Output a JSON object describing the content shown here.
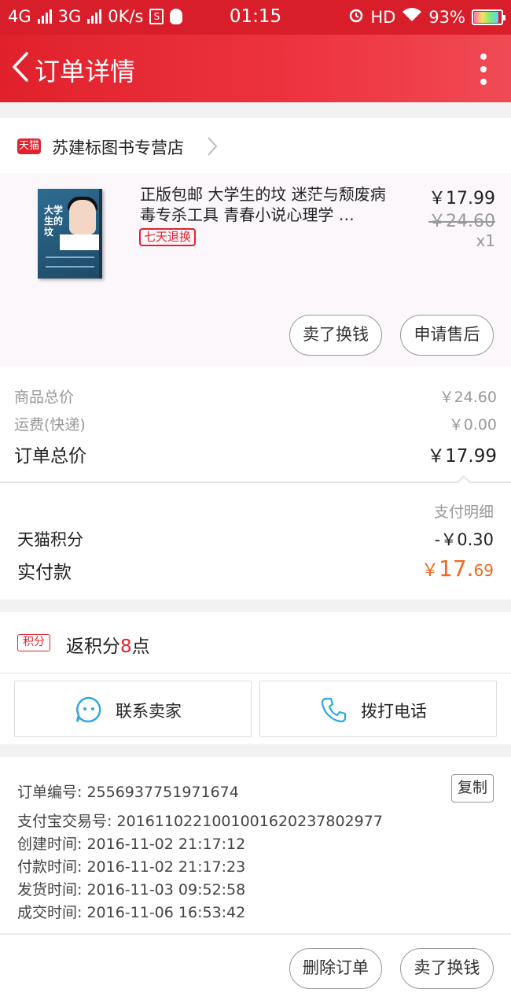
{
  "status_bar": {
    "network1": "4G",
    "network2": "3G",
    "speed": "0K/s",
    "time": "01:15",
    "hd": "HD",
    "battery": "93%"
  },
  "nav": {
    "title": "订单详情"
  },
  "shop": {
    "badge": "天猫",
    "name": "苏建标图书专营店"
  },
  "product": {
    "title": "正版包邮 大学生的坟 迷茫与颓废病毒专杀工具 青春小说心理学 …",
    "cover_title": "大学生的坟",
    "tag": "七天退换",
    "price": "￥17.99",
    "old_price": "￥24.60",
    "quantity": "x1",
    "btn_sell": "卖了换钱",
    "btn_aftersale": "申请售后"
  },
  "totals": {
    "goods_label": "商品总价",
    "goods_value": "￥24.60",
    "shipping_label": "运费(快递)",
    "shipping_value": "￥0.00",
    "order_label": "订单总价",
    "order_value": "￥17.99"
  },
  "payment": {
    "detail_label": "支付明细",
    "points_label": "天猫积分",
    "points_value": "-￥0.30",
    "paid_label": "实付款",
    "paid_currency": "￥",
    "paid_int": "17.",
    "paid_dec": "69"
  },
  "points": {
    "badge": "积分",
    "text_prefix": "返积分",
    "count": "8",
    "text_suffix": "点"
  },
  "contact": {
    "seller_label": "联系卖家",
    "phone_label": "拨打电话"
  },
  "info": {
    "order_no": "订单编号: 2556937751971674",
    "copy_label": "复制",
    "alipay_no": "支付宝交易号: 2016110221001001620237802977",
    "created": "创建时间: 2016-11-02 21:17:12",
    "paid": "付款时间: 2016-11-02 21:17:23",
    "shipped": "发货时间: 2016-11-03 09:52:58",
    "completed": "成交时间: 2016-11-06 16:53:42"
  },
  "bottom": {
    "delete_label": "删除订单",
    "sell_label": "卖了换钱"
  },
  "colors": {
    "brand_red": "#d81e2a",
    "accent_orange": "#f06a1e"
  }
}
